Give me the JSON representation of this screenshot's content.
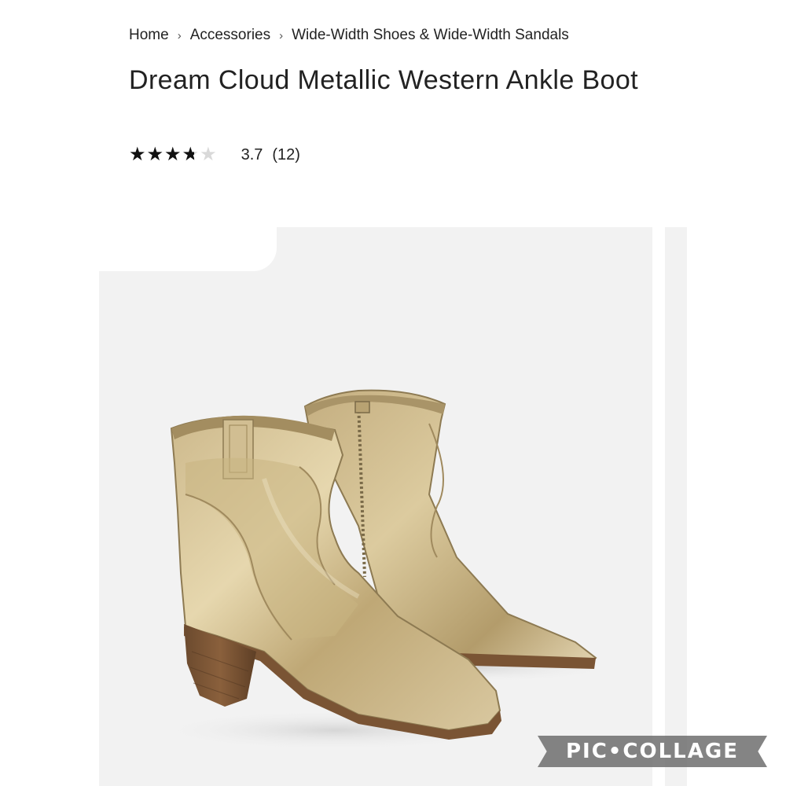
{
  "breadcrumb": {
    "items": [
      "Home",
      "Accessories",
      "Wide-Width Shoes & Wide-Width Sandals"
    ],
    "separator": "›"
  },
  "product": {
    "title": "Dream Cloud Metallic Western Ankle Boot",
    "rating": {
      "stars_glyphs": "★★★★★",
      "value": 3.7,
      "max": 5,
      "score_text": "3.7",
      "count_text": "(12)"
    }
  },
  "gallery": {
    "image_icon": "boot-photo",
    "background": "#f2f2f2"
  },
  "watermark": {
    "text": "PIC•COLLAGE"
  },
  "colors": {
    "text": "#222222",
    "star_filled": "#111111",
    "star_empty": "#d9d9d9",
    "gold_light": "#e3d3a8",
    "gold_dark": "#9c8656",
    "heel": "#7a5434"
  }
}
